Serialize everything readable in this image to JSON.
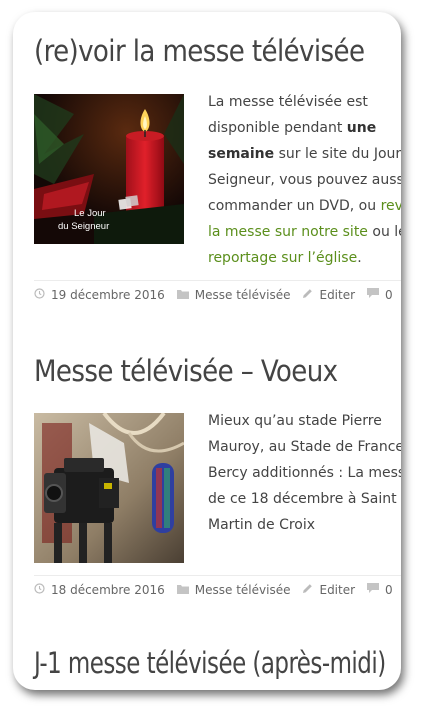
{
  "posts": [
    {
      "title": "(re)voir la messe télévisée",
      "thumb_caption": {
        "line1": "Le Jour",
        "line2": "du Seigneur"
      },
      "excerpt": {
        "l1": "La messe télévisée est",
        "l2a": "disponible pendant ",
        "l2b": "une",
        "l3a": "semaine",
        "l3b": " sur le site du Jour du",
        "l4": "Seigneur, vous pouvez aussi",
        "l5a": "commander un DVD, ou  ",
        "l5b": "revoir",
        "l6a": "la messe sur notre site",
        "l6b": " ou le",
        "l7a": "reportage sur l’église",
        "l7b": "."
      },
      "meta": {
        "date": "19 décembre 2016",
        "category": "Messe télévisée",
        "edit": "Editer",
        "comments": "0"
      }
    },
    {
      "title": "Messe télévisée – Voeux",
      "excerpt": {
        "l1": "Mieux qu’au stade Pierre",
        "l2": "Mauroy, au Stade de France et",
        "l3": "Bercy additionnés : La messe",
        "l4": "de ce 18 décembre à Saint",
        "l5": "Martin de Croix"
      },
      "meta": {
        "date": "18 décembre 2016",
        "category": "Messe télévisée",
        "edit": "Editer",
        "comments": "0"
      }
    },
    {
      "title": "J-1 messe télévisée (après-midi)"
    }
  ],
  "colors": {
    "text": "#444444",
    "link": "#5b8f1c",
    "meta": "#666666"
  }
}
